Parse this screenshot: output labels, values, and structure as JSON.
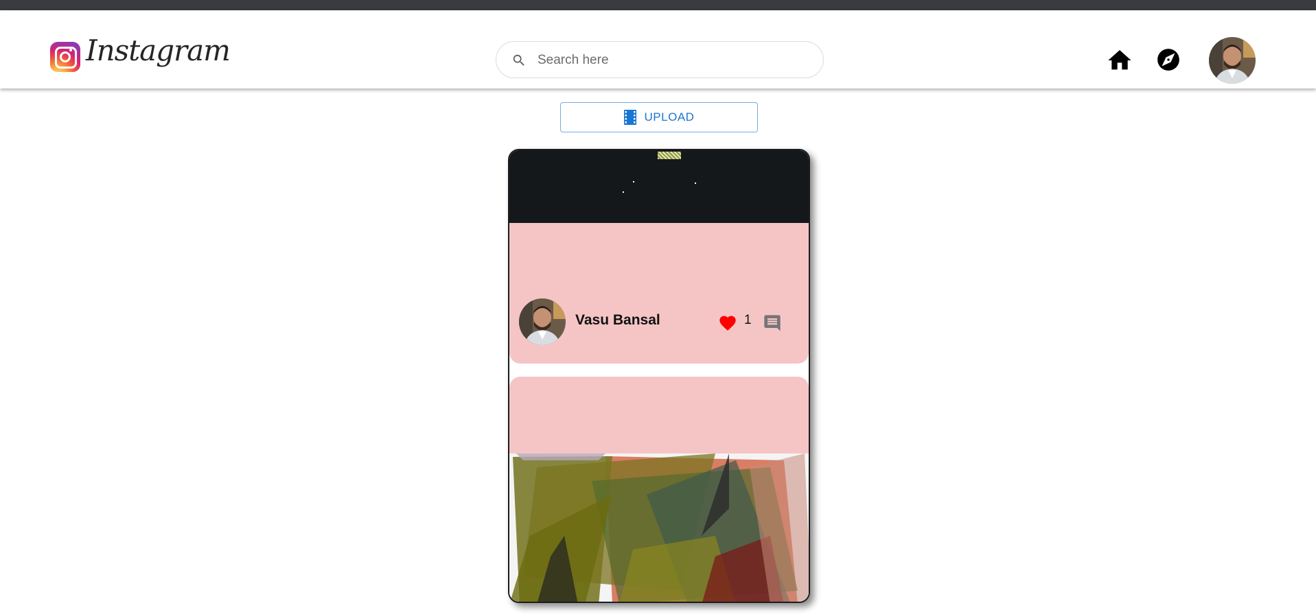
{
  "brand": {
    "name": "Instagram"
  },
  "search": {
    "placeholder": "Search here",
    "value": ""
  },
  "nav": {
    "home_icon": "home-icon",
    "explore_icon": "explore-icon",
    "avatar": "profile-avatar"
  },
  "upload": {
    "label": "UPLOAD",
    "icon": "movie-film-icon"
  },
  "post": {
    "username": "Vasu Bansal",
    "likes": "1",
    "liked": true,
    "like_icon": "heart-icon",
    "comment_icon": "comment-icon"
  },
  "colors": {
    "accent": "#1976d2",
    "like": "#ff0000",
    "card_background": "#f5c5c6",
    "comment_icon": "#757575"
  }
}
